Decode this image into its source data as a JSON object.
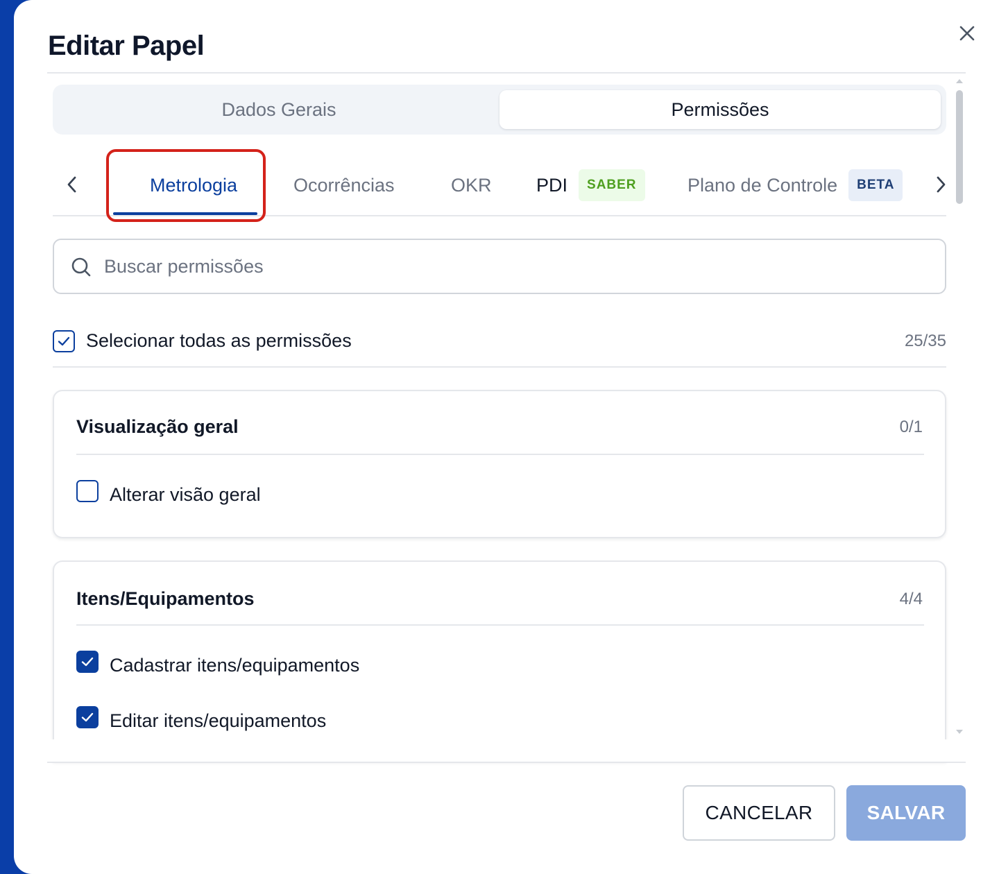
{
  "dialog": {
    "title": "Editar Papel"
  },
  "segmented": {
    "tabs": [
      {
        "label": "Dados Gerais",
        "active": false
      },
      {
        "label": "Permissões",
        "active": true
      }
    ]
  },
  "module_tabs": {
    "items": [
      {
        "label": "Metrologia",
        "active": true
      },
      {
        "label": "Ocorrências"
      },
      {
        "label": "OKR"
      },
      {
        "label": "PDI",
        "badge": "SABER"
      },
      {
        "label": "Plano de Controle",
        "badge": "BETA"
      }
    ]
  },
  "search": {
    "placeholder": "Buscar permissões",
    "value": ""
  },
  "select_all": {
    "label": "Selecionar todas as permissões",
    "checked": true,
    "count": "25/35"
  },
  "groups": [
    {
      "title": "Visualização geral",
      "count": "0/1",
      "permissions": [
        {
          "label": "Alterar visão geral",
          "checked": false
        }
      ]
    },
    {
      "title": "Itens/Equipamentos",
      "count": "4/4",
      "permissions": [
        {
          "label": "Cadastrar itens/equipamentos",
          "checked": true
        },
        {
          "label": "Editar itens/equipamentos",
          "checked": true
        }
      ]
    }
  ],
  "footer": {
    "cancel_label": "CANCELAR",
    "save_label": "SALVAR"
  },
  "colors": {
    "accent": "#0b3f9e",
    "highlight": "#d4221a",
    "save_disabled": "#8aa9dd",
    "saber_badge_text": "#4e9f1f",
    "beta_badge_text": "#1f3f75"
  }
}
